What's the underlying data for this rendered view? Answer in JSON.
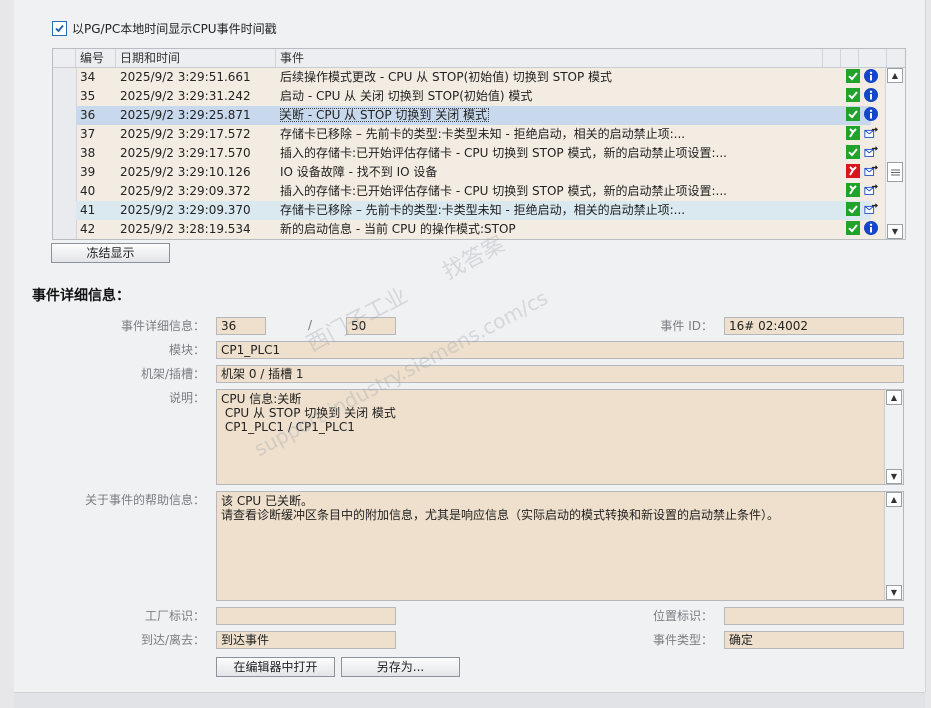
{
  "options": {
    "show_local_time_label": "以PG/PC本地时间显示CPU事件时间戳",
    "show_local_time_checked": true
  },
  "grid": {
    "columns": [
      "编号",
      "日期和时间",
      "事件"
    ],
    "rows": [
      {
        "no": "34",
        "datetime": "2025/9/2 3:29:51.661",
        "event": "后续操作模式更改 - CPU 从 STOP(初始值) 切换到 STOP 模式",
        "icons": [
          "ok-icon",
          "info-icon"
        ],
        "state": "normal"
      },
      {
        "no": "35",
        "datetime": "2025/9/2 3:29:31.242",
        "event": "启动 - CPU 从 关闭 切换到 STOP(初始值) 模式",
        "icons": [
          "ok-icon",
          "info-icon"
        ],
        "state": "normal"
      },
      {
        "no": "36",
        "datetime": "2025/9/2 3:29:25.871",
        "event": "关断 - CPU 从 STOP 切换到 关闭 模式",
        "icons": [
          "ok-icon",
          "info-icon"
        ],
        "state": "selected"
      },
      {
        "no": "37",
        "datetime": "2025/9/2 3:29:17.572",
        "event": "存储卡已移除 – 先前卡的类型:卡类型未知 - 拒绝启动，相关的启动禁止项:...",
        "icons": [
          "maintenance-icon",
          "outgoing-icon"
        ],
        "state": "normal"
      },
      {
        "no": "38",
        "datetime": "2025/9/2 3:29:17.570",
        "event": "插入的存储卡:已开始评估存储卡 - CPU 切换到 STOP 模式，新的启动禁止项设置:...",
        "icons": [
          "ok-icon",
          "outgoing-icon"
        ],
        "state": "normal"
      },
      {
        "no": "39",
        "datetime": "2025/9/2 3:29:10.126",
        "event": "IO 设备故障 - 找不到 IO 设备",
        "icons": [
          "error-icon",
          "outgoing-icon"
        ],
        "state": "normal"
      },
      {
        "no": "40",
        "datetime": "2025/9/2 3:29:09.372",
        "event": "插入的存储卡:已开始评估存储卡 - CPU 切换到 STOP 模式，新的启动禁止项设置:...",
        "icons": [
          "maintenance-icon",
          "outgoing-icon"
        ],
        "state": "normal"
      },
      {
        "no": "41",
        "datetime": "2025/9/2 3:29:09.370",
        "event": "存储卡已移除 – 先前卡的类型:卡类型未知 - 拒绝启动，相关的启动禁止项:...",
        "icons": [
          "ok-icon",
          "outgoing-icon"
        ],
        "state": "alt"
      },
      {
        "no": "42",
        "datetime": "2025/9/2 3:28:19.534",
        "event": "新的启动信息 - 当前 CPU 的操作模式:STOP",
        "icons": [
          "ok-icon",
          "info-icon"
        ],
        "state": "normal"
      }
    ]
  },
  "freeze_button": "冻结显示",
  "details": {
    "title": "事件详细信息：",
    "labels": {
      "detail_info": "事件详细信息：",
      "module": "模块：",
      "rack_slot": "机架/插槽：",
      "description": "说明：",
      "help": "关于事件的帮助信息：",
      "plant_id": "工厂标识：",
      "arrive_leave": "到达/离去：",
      "event_id": "事件 ID：",
      "location_id": "位置标识：",
      "event_type": "事件类型："
    },
    "event_index": "36",
    "event_total": "50",
    "event_id": "16# 02:4002",
    "module": "CP1_PLC1",
    "rack_slot": "机架 0 / 插槽 1",
    "description_lines": [
      "CPU 信息:关断",
      " CPU 从 STOP 切换到 关闭 模式",
      "",
      " CP1_PLC1 / CP1_PLC1"
    ],
    "help_lines": [
      "该 CPU 已关断。",
      "请查看诊断缓冲区条目中的附加信息，尤其是响应信息（实际启动的模式转换和新设置的启动禁止条件）。"
    ],
    "plant_id": "",
    "location_id": "",
    "arrive_leave": "到达事件",
    "event_type": "确定"
  },
  "buttons": {
    "open_in_editor": "在编辑器中打开",
    "save_as": "另存为..."
  },
  "watermark": {
    "line1": "找答案",
    "line2": "support.industry.siemens.com/cs",
    "line3": "西门子工业"
  }
}
